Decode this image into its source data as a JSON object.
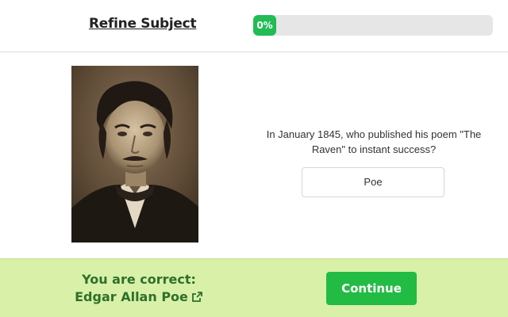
{
  "header": {
    "title": "Refine Subject",
    "progress_label": "0%",
    "progress_value": 0,
    "progress_color": "#22bb55"
  },
  "question": {
    "text": "In January 1845, who published his poem \"The Raven\" to instant success?",
    "answer_value": "Poe"
  },
  "portrait": {
    "icon": "portrait-photo"
  },
  "feedback": {
    "status_line": "You are correct:",
    "answer_name": "Edgar Allan Poe",
    "link_icon": "external-link-icon",
    "continue_label": "Continue",
    "bar_color": "#d8f0a8",
    "button_color": "#22bb44"
  }
}
